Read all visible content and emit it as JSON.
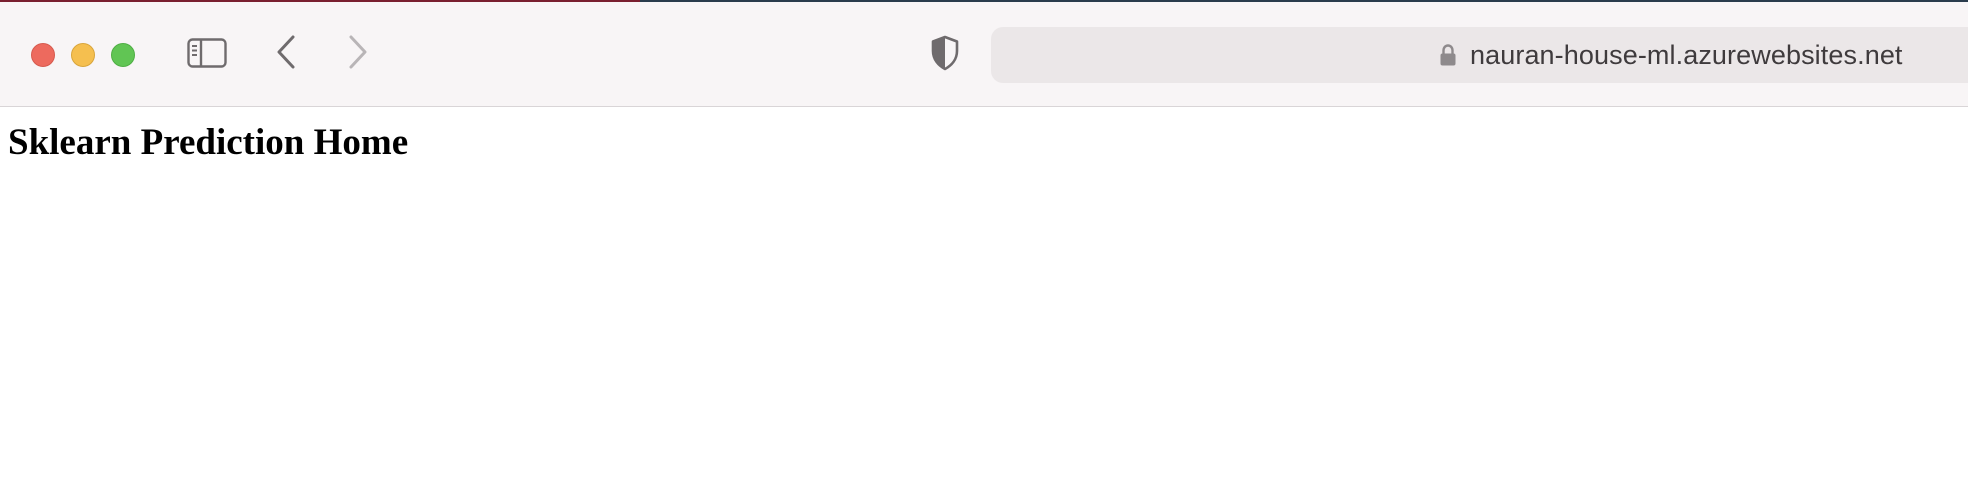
{
  "browser": {
    "window_controls": {
      "close_color": "#ed6a5e",
      "minimize_color": "#f5bf4f",
      "maximize_color": "#61c554"
    },
    "icons": {
      "sidebar": "sidebar-icon",
      "back": "chevron-left-icon",
      "forward": "chevron-right-icon",
      "privacy": "shield-icon",
      "secure": "lock-icon"
    },
    "address_bar": {
      "url": "nauran-house-ml.azurewebsites.net"
    }
  },
  "page": {
    "heading": "Sklearn Prediction Home"
  }
}
